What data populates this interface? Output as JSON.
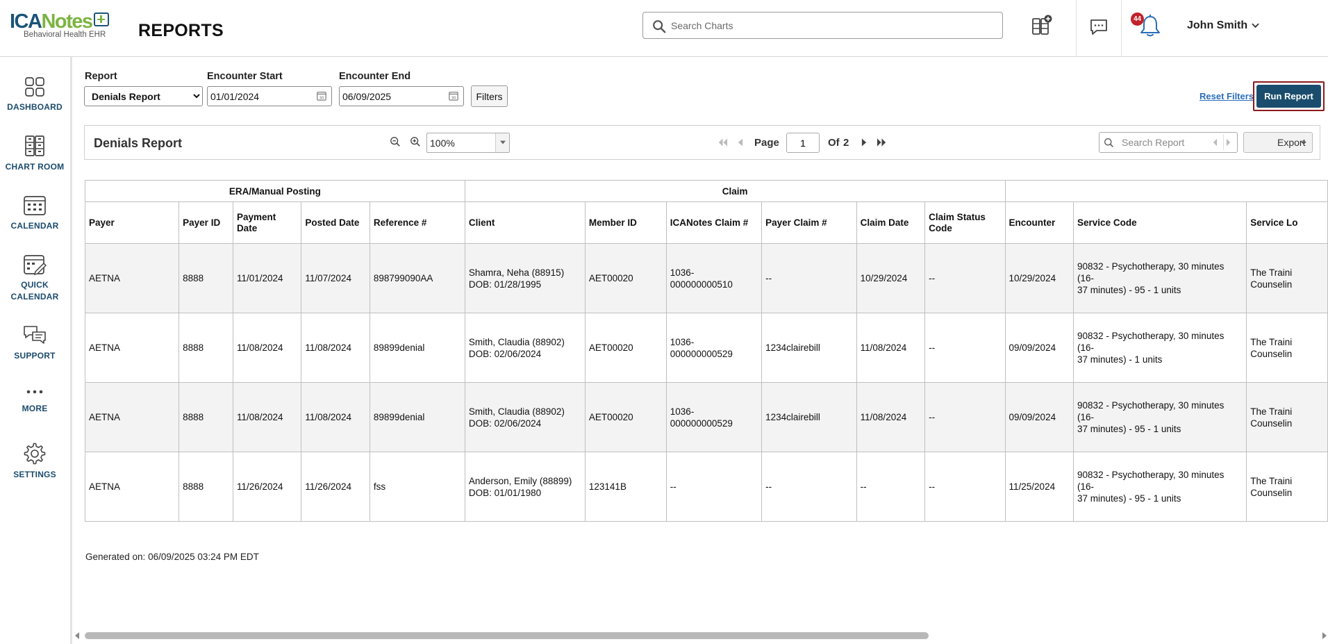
{
  "header": {
    "logo_primary": "ICA",
    "logo_secondary": "Notes",
    "logo_tagline": "Behavioral Health EHR",
    "page_title": "REPORTS",
    "search_placeholder": "Search Charts",
    "notification_count": "44",
    "user_name": "John Smith",
    "icons": [
      "search-icon",
      "chart-add-icon",
      "chat-icon",
      "bell-icon",
      "chevron-down-icon"
    ]
  },
  "sidebar": {
    "items": [
      {
        "label": "DASHBOARD",
        "icon": "dashboard-icon"
      },
      {
        "label": "CHART ROOM",
        "icon": "chart-room-icon"
      },
      {
        "label": "CALENDAR",
        "icon": "calendar-icon"
      },
      {
        "label_line1": "QUICK",
        "label_line2": "CALENDAR",
        "icon": "quick-calendar-icon"
      },
      {
        "label": "SUPPORT",
        "icon": "support-icon"
      },
      {
        "label": "MORE",
        "icon": "more-icon"
      },
      {
        "label": "SETTINGS",
        "icon": "gear-icon"
      }
    ]
  },
  "filters": {
    "report_label": "Report",
    "report_value": "Denials Report",
    "encounter_start_label": "Encounter Start",
    "encounter_start_value": "01/01/2024",
    "encounter_end_label": "Encounter End",
    "encounter_end_value": "06/09/2025",
    "filters_button": "Filters",
    "reset_link": "Reset Filters",
    "run_button": "Run Report"
  },
  "toolbar": {
    "report_title": "Denials Report",
    "zoom_value": "100%",
    "page_label": "Page",
    "page_value": "1",
    "of_label": "Of",
    "total_pages": "2",
    "search_placeholder": "Search Report",
    "export_label": "Export"
  },
  "table": {
    "groups": [
      "ERA/Manual Posting",
      "Claim",
      ""
    ],
    "columns": [
      "Payer",
      "Payer ID",
      "Payment Date",
      "Posted Date",
      "Reference #",
      "Client",
      "Member ID",
      "ICANotes Claim #",
      "Payer Claim #",
      "Claim Date",
      "Claim Status Code",
      "Encounter",
      "Service Code",
      "Service Lo"
    ],
    "rows": [
      {
        "payer": "AETNA",
        "payer_id": "8888",
        "payment_date": "11/01/2024",
        "posted_date": "11/07/2024",
        "reference": "898799090AA",
        "client_name": "Shamra, Neha (88915)",
        "client_dob": "DOB: 01/28/1995",
        "member_id": "AET00020",
        "icanotes_claim_1": "1036-",
        "icanotes_claim_2": "000000000510",
        "payer_claim": "--",
        "claim_date": "10/29/2024",
        "claim_status": "--",
        "encounter": "10/29/2024",
        "service_code_1": "90832 - Psychotherapy, 30 minutes (16-",
        "service_code_2": "37 minutes) - 95  - 1 units",
        "service_loc_1": "The Traini",
        "service_loc_2": "Counselin"
      },
      {
        "payer": "AETNA",
        "payer_id": "8888",
        "payment_date": "11/08/2024",
        "posted_date": "11/08/2024",
        "reference": "89899denial",
        "client_name": "Smith, Claudia (88902)",
        "client_dob": "DOB: 02/06/2024",
        "member_id": "AET00020",
        "icanotes_claim_1": "1036-",
        "icanotes_claim_2": "000000000529",
        "payer_claim": "1234clairebill",
        "claim_date": "11/08/2024",
        "claim_status": "--",
        "encounter": "09/09/2024",
        "service_code_1": "90832 - Psychotherapy, 30 minutes (16-",
        "service_code_2": "37 minutes) - 1 units",
        "service_loc_1": "The Traini",
        "service_loc_2": "Counselin"
      },
      {
        "payer": "AETNA",
        "payer_id": "8888",
        "payment_date": "11/08/2024",
        "posted_date": "11/08/2024",
        "reference": "89899denial",
        "client_name": "Smith, Claudia (88902)",
        "client_dob": "DOB: 02/06/2024",
        "member_id": "AET00020",
        "icanotes_claim_1": "1036-",
        "icanotes_claim_2": "000000000529",
        "payer_claim": "1234clairebill",
        "claim_date": "11/08/2024",
        "claim_status": "--",
        "encounter": "09/09/2024",
        "service_code_1": "90832 - Psychotherapy, 30 minutes (16-",
        "service_code_2": "37 minutes) - 95  - 1 units",
        "service_loc_1": "The Traini",
        "service_loc_2": "Counselin"
      },
      {
        "payer": "AETNA",
        "payer_id": "8888",
        "payment_date": "11/26/2024",
        "posted_date": "11/26/2024",
        "reference": "fss",
        "client_name": "Anderson, Emily (88899)",
        "client_dob": "DOB: 01/01/1980",
        "member_id": "123141B",
        "icanotes_claim_1": "--",
        "icanotes_claim_2": "",
        "payer_claim": "--",
        "claim_date": "--",
        "claim_status": "--",
        "encounter": "11/25/2024",
        "service_code_1": "90832 - Psychotherapy, 30 minutes (16-",
        "service_code_2": "37 minutes) - 95  - 1 units",
        "service_loc_1": "The Traini",
        "service_loc_2": "Counselin"
      }
    ]
  },
  "footer": {
    "generated_on": "Generated on: 06/09/2025 03:24 PM EDT"
  },
  "colors": {
    "brand_navy": "#1b5477",
    "brand_green": "#7cb342",
    "run_button": "#1a4d6d",
    "run_highlight": "#8b1a1a",
    "badge": "#c0232a",
    "link": "#2a6ebb"
  }
}
